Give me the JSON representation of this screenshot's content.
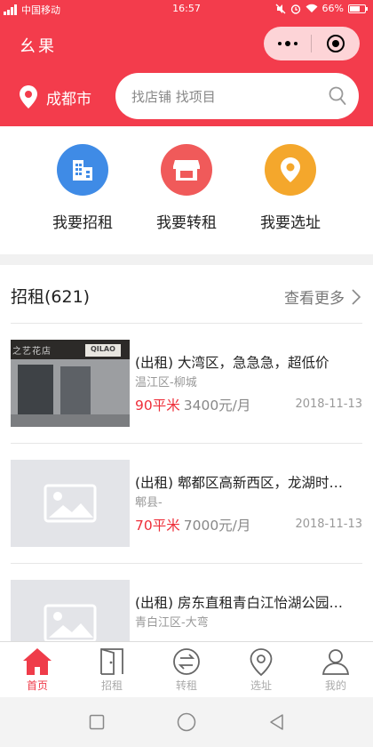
{
  "status_bar": {
    "carrier": "中国移动",
    "time": "16:57",
    "battery": "66%"
  },
  "header": {
    "app_title": "幺果",
    "city": "成都市",
    "search_placeholder": "找店铺 找项目"
  },
  "quick_actions": [
    {
      "label": "我要招租",
      "icon": "building-icon",
      "color": "#3f8be6"
    },
    {
      "label": "我要转租",
      "icon": "storefront-icon",
      "color": "#f05a5a"
    },
    {
      "label": "我要选址",
      "icon": "location-pin-icon",
      "color": "#f4a72c"
    }
  ],
  "section": {
    "title": "招租(621)",
    "more": "查看更多"
  },
  "listings": [
    {
      "title": "(出租) 大湾区，急急急，超低价",
      "location": "温江区-柳城",
      "area": "90平米",
      "price": "3400元/月",
      "date": "2018-11-13",
      "has_photo": true
    },
    {
      "title": "(出租) 郫都区高新西区，龙湖时…",
      "location": "郫县-",
      "area": "70平米",
      "price": "7000元/月",
      "date": "2018-11-13",
      "has_photo": false
    },
    {
      "title": "(出租) 房东直租青白江怡湖公园…",
      "location": "青白江区-大弯",
      "area": "",
      "price": "",
      "date": "",
      "has_photo": false
    }
  ],
  "photo_sign": {
    "left_text": "之艺花店",
    "right_text": "QILAO"
  },
  "tabs": [
    {
      "label": "首页",
      "icon": "home-icon",
      "active": true
    },
    {
      "label": "招租",
      "icon": "door-icon",
      "active": false
    },
    {
      "label": "转租",
      "icon": "transfer-icon",
      "active": false
    },
    {
      "label": "选址",
      "icon": "map-pin-icon",
      "active": false
    },
    {
      "label": "我的",
      "icon": "user-icon",
      "active": false
    }
  ],
  "colors": {
    "brand": "#f33c4c",
    "price_red": "#ee2f3a"
  }
}
